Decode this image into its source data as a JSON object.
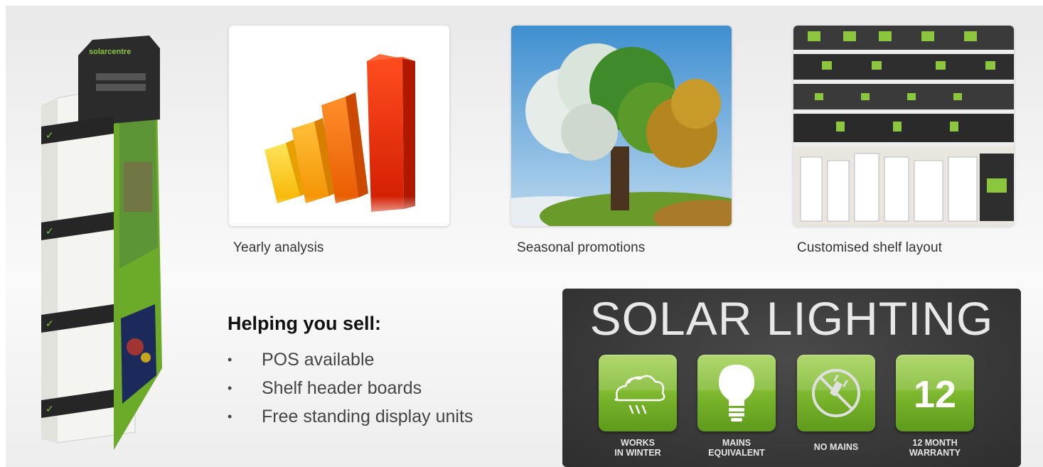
{
  "stand": {
    "brand_text": "solarcentre",
    "icon": "solarcentre-display-stand-image"
  },
  "tiles": [
    {
      "caption": "Yearly analysis",
      "icon": "bar-chart-photo"
    },
    {
      "caption": "Seasonal promotions",
      "icon": "four-seasons-tree-photo"
    },
    {
      "caption": "Customised shelf layout",
      "icon": "store-shelf-photo"
    }
  ],
  "sell": {
    "heading": "Helping you sell:",
    "bullet": "•",
    "items": [
      "POS available",
      "Shelf header boards",
      "Free standing display units"
    ]
  },
  "banner": {
    "title": "SOLAR LIGHTING",
    "badges": [
      {
        "label": "WORKS\nIN WINTER",
        "icon": "rain-cloud-icon"
      },
      {
        "label": "MAINS\nEQUIVALENT",
        "icon": "light-bulb-icon"
      },
      {
        "label": "NO MAINS",
        "icon": "no-plug-icon"
      },
      {
        "label": "12 MONTH\nWARRANTY",
        "value": "12",
        "icon": "twelve-badge"
      }
    ]
  },
  "colors": {
    "brand_green": "#7ab52c",
    "banner_dark": "#3a3a3a"
  }
}
